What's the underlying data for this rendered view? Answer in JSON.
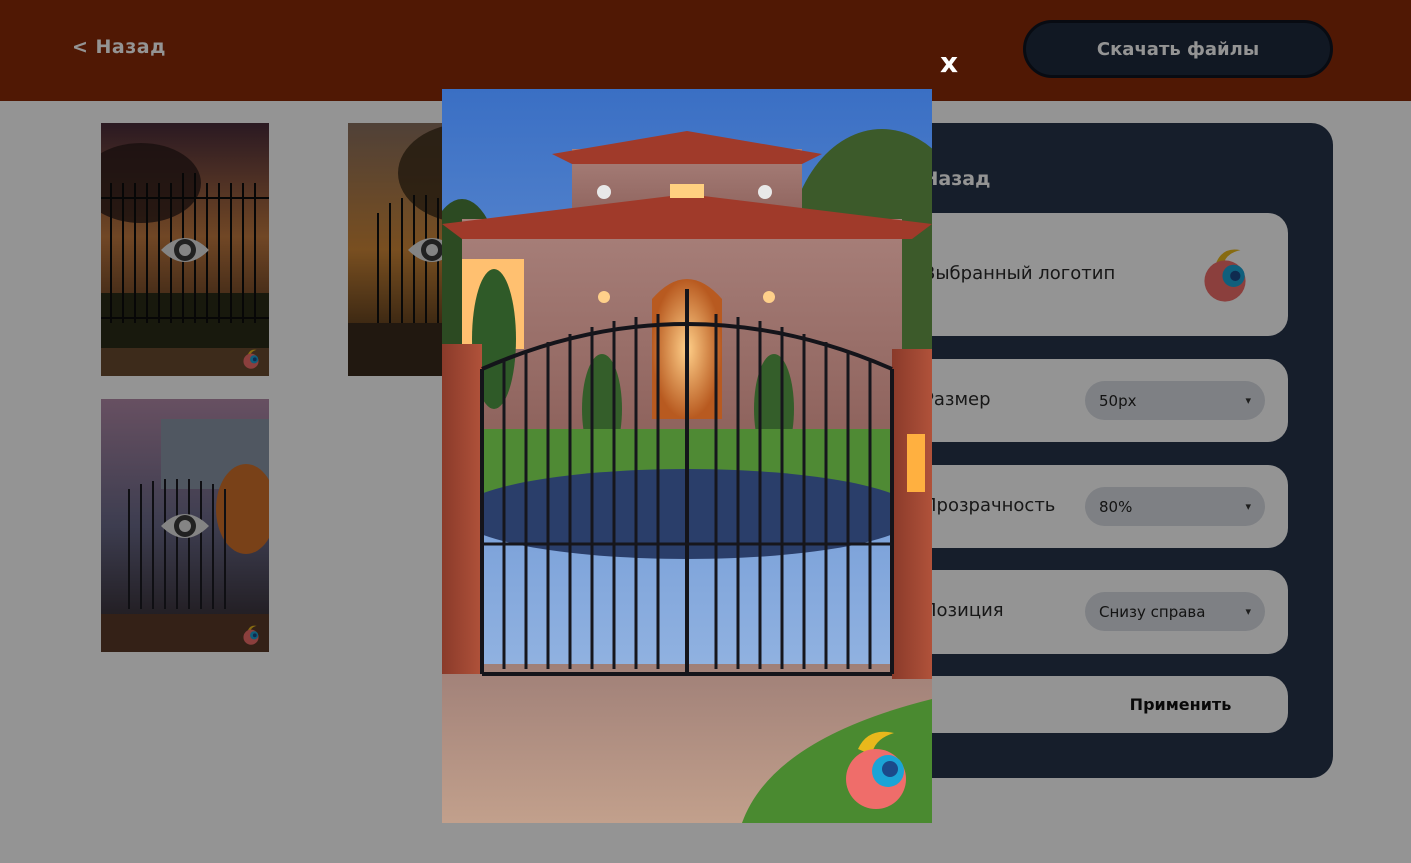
{
  "header": {
    "back_label": "< Назад",
    "download_label": "Скачать файлы"
  },
  "settings": {
    "back_label": "< Назад",
    "logo_label": "Выбранный логотип",
    "size_label": "Размер",
    "size_value": "50px",
    "opacity_label": "Прозрачность",
    "opacity_value": "80%",
    "position_label": "Позиция",
    "position_value": "Снизу справа",
    "apply_label": "Применить"
  },
  "modal": {
    "close_label": "x"
  },
  "colors": {
    "header_bg": "#8b2a08",
    "panel_bg": "#27344a",
    "button_dark": "#1e2a3d"
  },
  "icons": [
    "eye-icon",
    "logo-icon",
    "close-icon",
    "chevron-down-icon"
  ]
}
